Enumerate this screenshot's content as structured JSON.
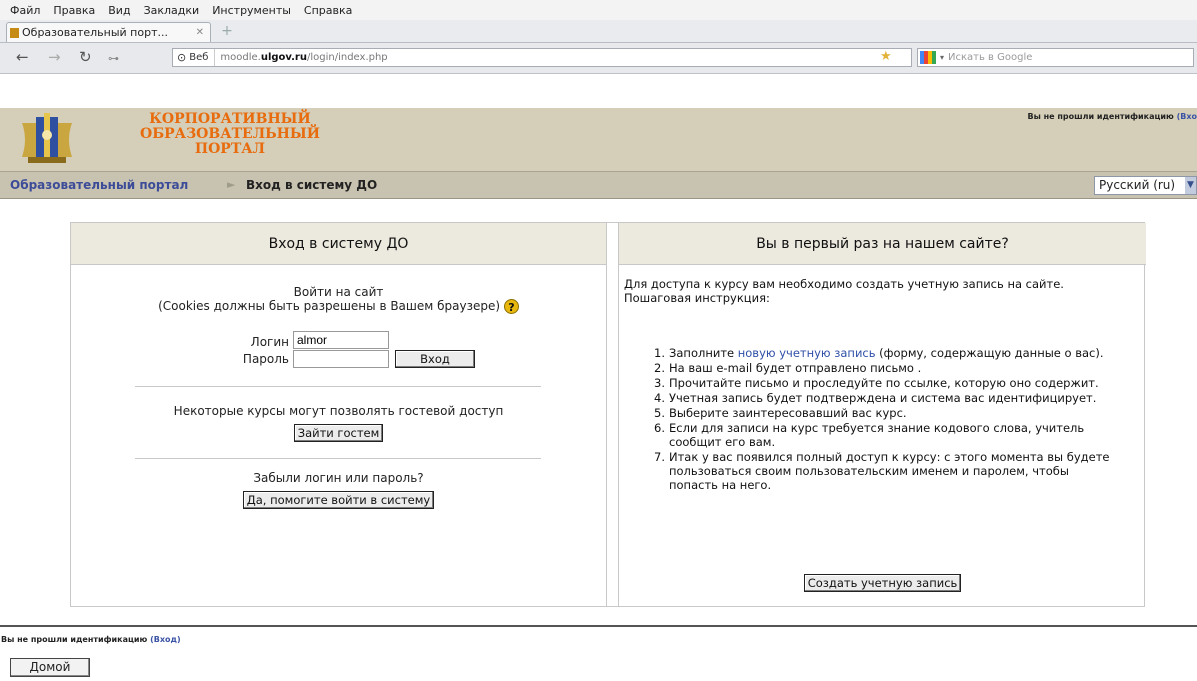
{
  "browser": {
    "menu": [
      "Файл",
      "Правка",
      "Вид",
      "Закладки",
      "Инструменты",
      "Справка"
    ],
    "tab_title": "Образовательный порт...",
    "site_label": "Веб",
    "url_domain": "moodle.",
    "url_domain_bold": "ulgov.ru",
    "url_path": "/login/index.php",
    "search_placeholder": "Искать в Google"
  },
  "header": {
    "title_lines": [
      "КОРПОРАТИВНЫЙ",
      "ОБРАЗОВАТЕЛЬНЫЙ",
      "ПОРТАЛ"
    ],
    "ident_text": "Вы не прошли идентификацию",
    "ident_link": "(Вхо"
  },
  "breadcrumb": {
    "home": "Образовательный портал",
    "separator": "►",
    "current": "Вход в систему ДО",
    "language": "Русский (ru)"
  },
  "login": {
    "heading": "Вход в систему ДО",
    "intro_line1": "Войти на сайт",
    "intro_line2": "(Cookies должны быть разрешены в Вашем браузере)",
    "username_label": "Логин",
    "username_value": "almor",
    "password_label": "Пароль",
    "login_button": "Вход",
    "guest_text": "Некоторые курсы могут позволять гостевой доступ",
    "guest_button": "Зайти гостем",
    "forgot_text": "Забыли логин или пароль?",
    "forgot_button": "Да, помогите войти в систему"
  },
  "signup": {
    "heading": "Вы в первый раз на нашем сайте?",
    "intro": "Для доступа к курсу вам необходимо создать учетную запись на сайте.",
    "instructions_label": "Пошаговая инструкция:",
    "step1_num": "1.",
    "step1_before": "Заполните ",
    "step1_link": "новую учетную запись",
    "step1_after": " (форму, содержащую данные о вас).",
    "steps": [
      {
        "num": "2.",
        "text": "На ваш e-mail будет отправлено письмо ."
      },
      {
        "num": "3.",
        "text": "Прочитайте письмо и проследуйте по ссылке, которую оно содержит."
      },
      {
        "num": "4.",
        "text": "Учетная запись будет подтверждена и система вас идентифицирует."
      },
      {
        "num": "5.",
        "text": "Выберите заинтересовавший вас курс."
      },
      {
        "num": "6.",
        "text": "Если для записи на курс требуется знание кодового слова, учитель сообщит его вам."
      },
      {
        "num": "7.",
        "text": "Итак у вас появился полный доступ к курсу: с этого момента вы будете пользоваться своим пользовательским именем и паролем, чтобы попасть на него."
      }
    ],
    "create_button": "Создать учетную запись"
  },
  "footer": {
    "ident_text": "Вы не прошли идентификацию",
    "ident_link": "(Вход)",
    "home_button": "Домой"
  },
  "colors": {
    "header_bg": "#d5cfb9",
    "title_orange": "#e86b0d",
    "link_blue": "#3050a8",
    "box_head_bg": "#ece9de"
  }
}
